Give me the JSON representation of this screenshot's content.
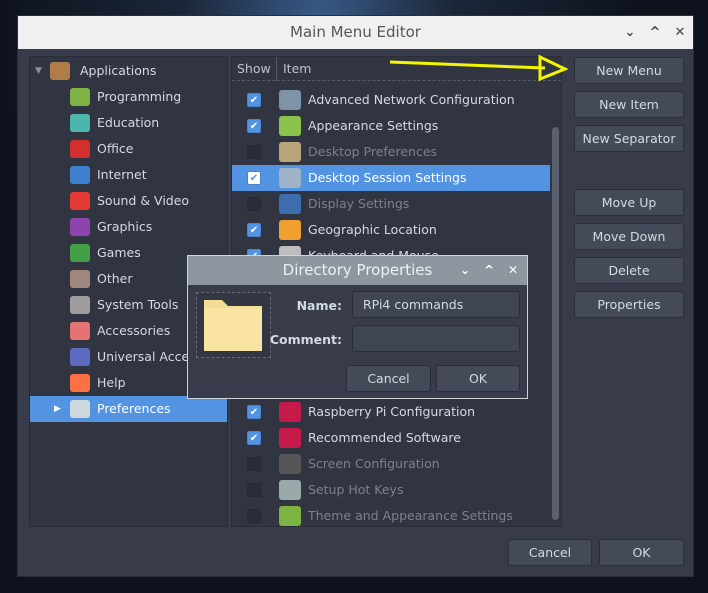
{
  "window": {
    "title": "Main Menu Editor"
  },
  "tree": {
    "root": "Applications",
    "items": [
      "Programming",
      "Education",
      "Office",
      "Internet",
      "Sound & Video",
      "Graphics",
      "Games",
      "Other",
      "System Tools",
      "Accessories",
      "Universal Access",
      "Help",
      "Preferences"
    ],
    "selected": "Preferences"
  },
  "list": {
    "headers": {
      "show": "Show",
      "item": "Item"
    },
    "rows": [
      {
        "label": "Advanced Network Configuration",
        "checked": true,
        "enabled": true,
        "icon": "network-icon"
      },
      {
        "label": "Appearance Settings",
        "checked": true,
        "enabled": true,
        "icon": "appearance-icon"
      },
      {
        "label": "Desktop Preferences",
        "checked": false,
        "enabled": false,
        "icon": "desktop-prefs-icon"
      },
      {
        "label": "Desktop Session Settings",
        "checked": true,
        "enabled": true,
        "selected": true,
        "icon": "session-icon"
      },
      {
        "label": "Display Settings",
        "checked": false,
        "enabled": false,
        "icon": "display-icon"
      },
      {
        "label": "Geographic Location",
        "checked": true,
        "enabled": true,
        "icon": "location-icon"
      },
      {
        "label": "Keyboard and Mouse",
        "checked": true,
        "enabled": true,
        "icon": "keyboard-icon"
      },
      {
        "label": "Raspberry Pi Configuration",
        "checked": true,
        "enabled": true,
        "icon": "raspberry-icon"
      },
      {
        "label": "Recommended Software",
        "checked": true,
        "enabled": true,
        "icon": "raspberry-icon"
      },
      {
        "label": "Screen Configuration",
        "checked": false,
        "enabled": false,
        "icon": "monitor-icon"
      },
      {
        "label": "Setup Hot Keys",
        "checked": false,
        "enabled": false,
        "icon": "hotkeys-icon"
      },
      {
        "label": "Theme and Appearance Settings",
        "checked": false,
        "enabled": false,
        "icon": "theme-icon"
      }
    ]
  },
  "buttons": {
    "new_menu": "New Menu",
    "new_item": "New Item",
    "new_separator": "New Separator",
    "move_up": "Move Up",
    "move_down": "Move Down",
    "delete": "Delete",
    "properties": "Properties",
    "cancel": "Cancel",
    "ok": "OK"
  },
  "dialog": {
    "title": "Directory Properties",
    "name_label": "Name:",
    "name_value": "RPi4 commands",
    "comment_label": "Comment:",
    "comment_value": "",
    "cancel": "Cancel",
    "ok": "OK"
  },
  "annotation": {
    "arrow_color": "#f5f500"
  },
  "colors": {
    "selection": "#5294e2",
    "window_bg": "#383c4a"
  }
}
